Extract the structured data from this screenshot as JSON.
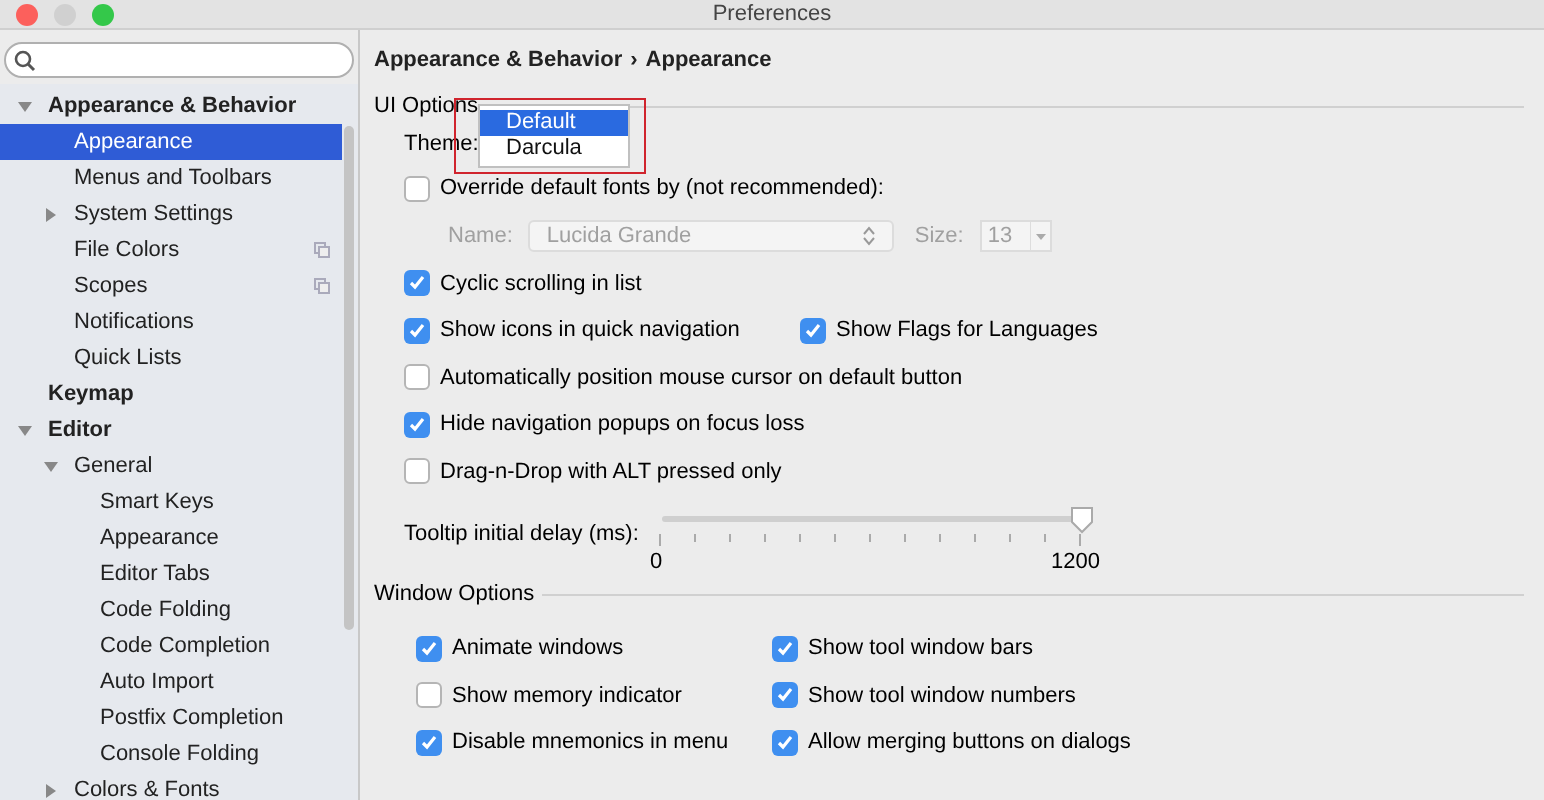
{
  "window": {
    "title": "Preferences"
  },
  "sidebar": {
    "items": [
      {
        "label": "Appearance & Behavior",
        "kind": "category",
        "expanded": true,
        "selected": false,
        "children": [
          {
            "label": "Appearance",
            "selected": true
          },
          {
            "label": "Menus and Toolbars",
            "selected": false
          },
          {
            "label": "System Settings",
            "selected": false,
            "expanded": false
          },
          {
            "label": "File Colors",
            "selected": false,
            "project_level": true
          },
          {
            "label": "Scopes",
            "selected": false,
            "project_level": true
          },
          {
            "label": "Notifications",
            "selected": false
          },
          {
            "label": "Quick Lists",
            "selected": false
          }
        ]
      },
      {
        "label": "Keymap",
        "kind": "category",
        "selected": false
      },
      {
        "label": "Editor",
        "kind": "category",
        "expanded": true,
        "selected": false,
        "children": [
          {
            "label": "General",
            "selected": false,
            "expanded": true,
            "children": [
              {
                "label": "Smart Keys",
                "selected": false
              },
              {
                "label": "Appearance",
                "selected": false
              },
              {
                "label": "Editor Tabs",
                "selected": false
              },
              {
                "label": "Code Folding",
                "selected": false
              },
              {
                "label": "Code Completion",
                "selected": false
              },
              {
                "label": "Auto Import",
                "selected": false
              },
              {
                "label": "Postfix Completion",
                "selected": false
              },
              {
                "label": "Console Folding",
                "selected": false
              }
            ]
          },
          {
            "label": "Colors & Fonts",
            "selected": false,
            "expanded": false
          }
        ]
      }
    ]
  },
  "breadcrumb": [
    "Appearance & Behavior",
    "›",
    "Appearance"
  ],
  "ui_options": {
    "title": "UI Options",
    "theme": {
      "label": "Theme:",
      "options": [
        {
          "label": "Default",
          "selected": true
        },
        {
          "label": "Darcula",
          "selected": false
        }
      ]
    },
    "override": {
      "label": "Override default fonts by (not recommended):",
      "checked": false
    },
    "font": {
      "name_label": "Name:",
      "name": "Lucida Grande",
      "size_label": "Size:",
      "size": "13",
      "disabled": true
    },
    "rows": [
      [
        {
          "label": "Cyclic scrolling in list",
          "checked": true
        }
      ],
      [
        {
          "label": "Show icons in quick navigation",
          "checked": true
        },
        {
          "label": "Show Flags for Languages",
          "checked": true
        }
      ],
      [
        {
          "label": "Automatically position mouse cursor on default button",
          "checked": false
        }
      ],
      [
        {
          "label": "Hide navigation popups on focus loss",
          "checked": true
        }
      ],
      [
        {
          "label": "Drag-n-Drop with ALT pressed only",
          "checked": false
        }
      ]
    ],
    "tooltip_delay": {
      "label": "Tooltip initial delay (ms):",
      "level": 1,
      "min_label": "0",
      "max_label": "1200"
    }
  },
  "window_options": {
    "title": "Window Options",
    "rows": [
      [
        {
          "label": "Animate windows",
          "checked": true
        },
        {
          "label": "Show tool window bars",
          "checked": true
        }
      ],
      [
        {
          "label": "Show memory indicator",
          "checked": false
        },
        {
          "label": "Show tool window numbers",
          "checked": true
        }
      ],
      [
        {
          "label": "Disable mnemonics in menu",
          "checked": true
        },
        {
          "label": "Allow merging buttons on dialogs",
          "checked": true
        }
      ]
    ]
  }
}
